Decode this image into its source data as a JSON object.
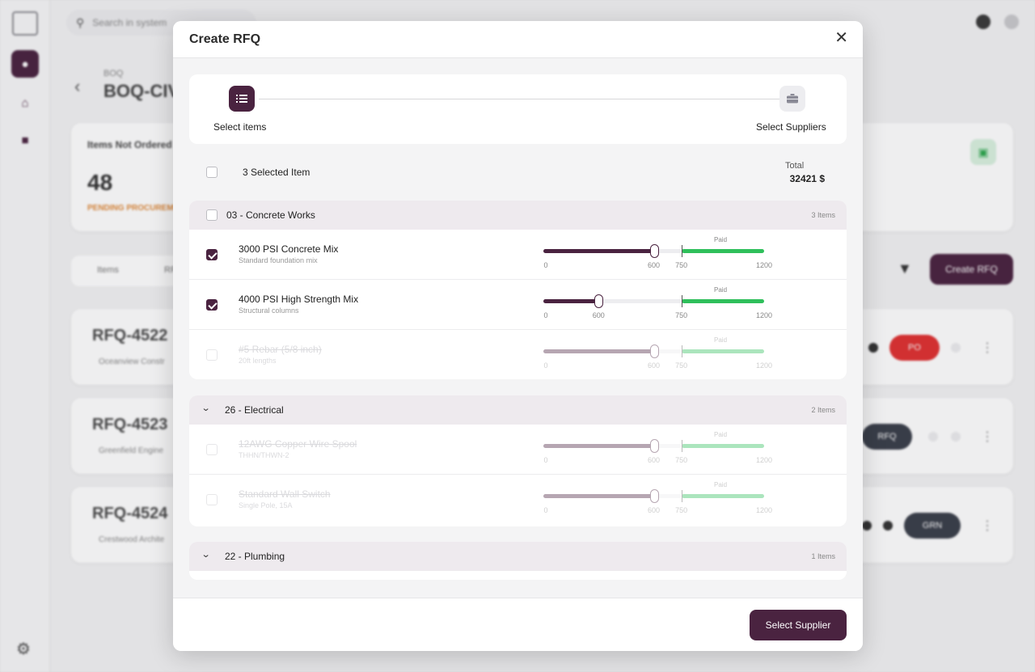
{
  "background": {
    "search_placeholder": "Search in system",
    "breadcrumb": "BOQ",
    "title": "BOQ-CIV",
    "stat_label": "Items Not Ordered",
    "stat_value": "48",
    "stat_sub": "PENDING PROCUREMENT",
    "tabs": [
      "Items",
      "RF"
    ],
    "create_rfq_label": "Create RFQ",
    "rfqs": [
      {
        "id": "RFQ-4522",
        "client": "Oceanview Constr",
        "badge": "PO",
        "badge_color": "#e03131"
      },
      {
        "id": "RFQ-4523",
        "client": "Greenfield Engine",
        "badge": "RFQ",
        "badge_color": "#3a3f4a"
      },
      {
        "id": "RFQ-4524",
        "client": "Crestwood Archite",
        "badge": "GRN",
        "badge_color": "#3a3f4a"
      }
    ]
  },
  "modal": {
    "title": "Create RFQ",
    "close_icon": "close-icon",
    "steps": [
      {
        "label": "Select items",
        "icon": "list-icon",
        "active": true
      },
      {
        "label": "Select Suppliers",
        "icon": "briefcase-icon",
        "active": false
      }
    ],
    "selected_text": "3 Selected Item",
    "total_label": "Total",
    "total_value": "32421 $",
    "groups": [
      {
        "title": "03 - Concrete Works",
        "count": "3 Items",
        "items": [
          {
            "name": "3000 PSI Concrete Mix",
            "desc": "Standard foundation mix",
            "checked": true,
            "disabled": false,
            "value": 600,
            "paid_from": 750,
            "max": 1200,
            "ticks": [
              "0",
              "600",
              "750",
              "1200"
            ],
            "paid_label": "Paid"
          },
          {
            "name": "4000 PSI High Strength Mix",
            "desc": "Structural columns",
            "checked": true,
            "disabled": false,
            "value": 300,
            "paid_from": 750,
            "max": 1200,
            "ticks": [
              "0",
              "600",
              "750",
              "1200"
            ],
            "paid_label": "Paid"
          },
          {
            "name": "#5 Rebar (5/8 inch)",
            "desc": "20ft lengths",
            "checked": false,
            "disabled": true,
            "value": 600,
            "paid_from": 750,
            "max": 1200,
            "ticks": [
              "0",
              "600",
              "750",
              "1200"
            ],
            "paid_label": "Paid"
          }
        ]
      },
      {
        "title": "26 - Electrical",
        "count": "2 Items",
        "items": [
          {
            "name": "12AWG Copper Wire Spool",
            "desc": "THHN/THWN-2",
            "checked": false,
            "disabled": true,
            "value": 600,
            "paid_from": 750,
            "max": 1200,
            "ticks": [
              "0",
              "600",
              "750",
              "1200"
            ],
            "paid_label": "Paid"
          },
          {
            "name": "Standard Wall Switch",
            "desc": "Single Pole, 15A",
            "checked": false,
            "disabled": true,
            "value": 600,
            "paid_from": 750,
            "max": 1200,
            "ticks": [
              "0",
              "600",
              "750",
              "1200"
            ],
            "paid_label": "Paid"
          }
        ]
      },
      {
        "title": "22 - Plumbing",
        "count": "1 Items",
        "items": []
      }
    ],
    "footer_button": "Select Supplier"
  },
  "colors": {
    "accent": "#4a2340",
    "paid_green": "#2fbf5b"
  }
}
